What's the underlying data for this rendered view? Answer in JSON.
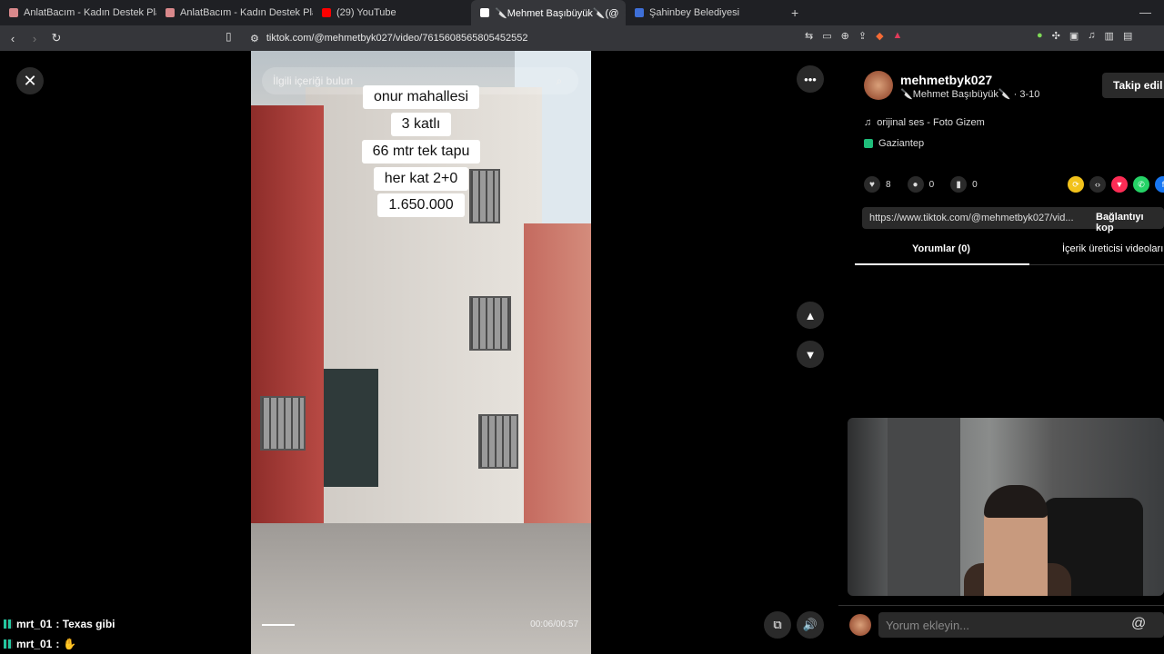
{
  "browser": {
    "tabs": [
      {
        "title": "AnlatBacım - Kadın Destek Platformu",
        "fav_color": "#d9888b"
      },
      {
        "title": "AnlatBacım - Kadın Destek Platformu",
        "fav_color": "#d9888b"
      },
      {
        "title": "(29) YouTube",
        "fav_color": "#ff0000"
      },
      {
        "title": "🔪Mehmet Başıbüyük🔪(@",
        "fav_color": "#ffffff",
        "active": true
      },
      {
        "title": "Şahinbey Belediyesi",
        "fav_color": "#3e6fd8"
      }
    ],
    "new_tab": "+",
    "minimize": "—",
    "url": "tiktok.com/@mehmetbyk027/video/7615608565805452552"
  },
  "video": {
    "search_placeholder": "İlgili içeriği bulun",
    "captions": [
      "onur mahallesi",
      "3 katlı",
      "66 mtr tek tapu",
      "her kat 2+0",
      "1.650.000"
    ],
    "time": "00:06/00:57",
    "progress": 0.1
  },
  "controls": {
    "close": "✕",
    "more": "•••",
    "up": "⌃",
    "down": "⌄"
  },
  "profile": {
    "username": "mehmetbyk027",
    "display": "🔪Mehmet Başıbüyük🔪 · 3-10",
    "follow": "Takip edil",
    "sound": "orijinal ses - Foto Gizem",
    "location": "Gaziantep",
    "likes": "8",
    "comments": "0",
    "saves": "0",
    "link": "https://www.tiktok.com/@mehmetbyk027/vid...",
    "copy_link": "Bağlantıyı kop",
    "tab_comments": "Yorumlar (0)",
    "tab_creator": "İçerik üreticisi videoları"
  },
  "comment_input": {
    "placeholder": "Yorum ekleyin...",
    "at": "@"
  },
  "chat": [
    {
      "user": "mrt_01",
      "text": ": Texas gibi"
    },
    {
      "user": "mrt_01",
      "text": ":"
    }
  ]
}
